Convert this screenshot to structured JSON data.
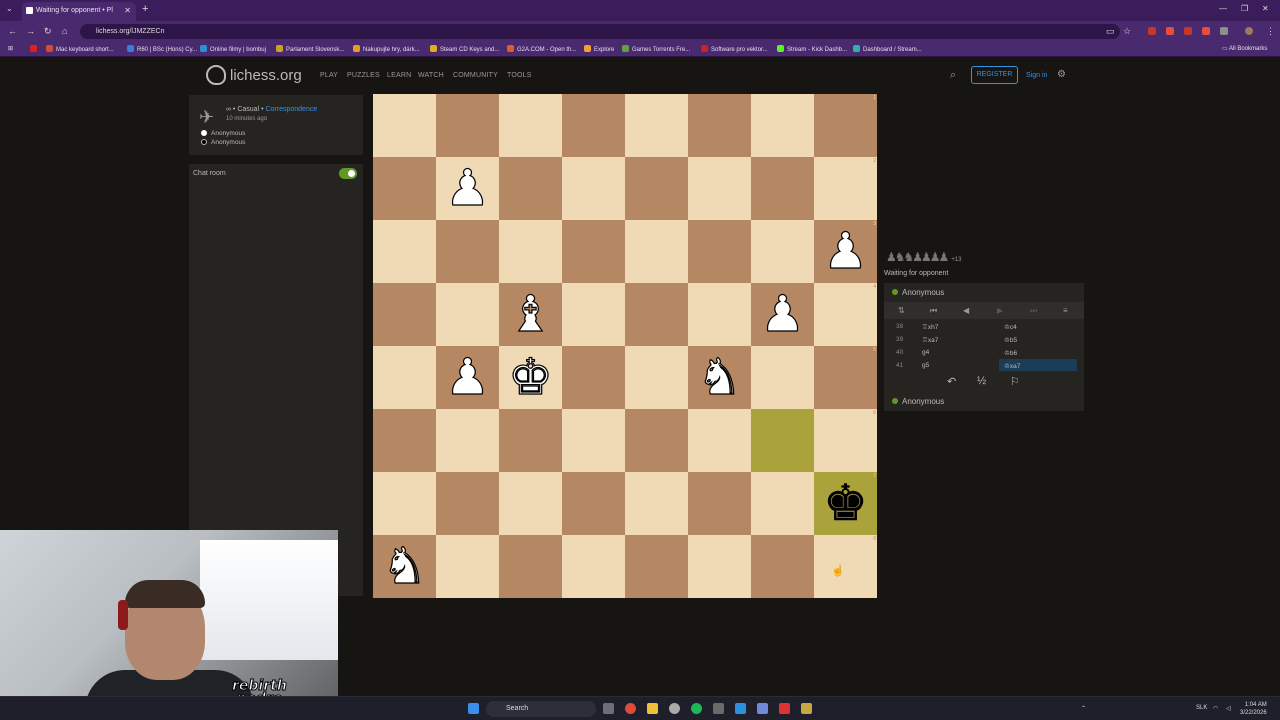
{
  "browser": {
    "tab_title": "Waiting for opponent • Pl",
    "url": "lichess.org/lJMZZECn",
    "bookmarks": [
      {
        "label": "Mac keyboard short...",
        "color": "#d14b3a"
      },
      {
        "label": "R60 | BSc (Hons) Cy...",
        "color": "#3b7dd8"
      },
      {
        "label": "Online filmy | bombuj",
        "color": "#2f8fd0"
      },
      {
        "label": "Parlament Slovensk...",
        "color": "#c9a227"
      },
      {
        "label": "Nakupujte hry, dárk...",
        "color": "#e0a020"
      },
      {
        "label": "Steam CD Keys and...",
        "color": "#e0b020"
      },
      {
        "label": "G2A.COM - Open th...",
        "color": "#e05a2a"
      },
      {
        "label": "Explore",
        "color": "#f0a030"
      },
      {
        "label": "Games Torrents Fre...",
        "color": "#62a043"
      },
      {
        "label": "Software pro vektor...",
        "color": "#d02020"
      },
      {
        "label": "Stream - Kick Dashb...",
        "color": "#53fc18"
      },
      {
        "label": "Dashboard / Stream...",
        "color": "#2ab3a6"
      }
    ],
    "all_bookmarks": "All Bookmarks"
  },
  "header": {
    "logo": "lichess.org",
    "nav": [
      "PLAY",
      "PUZZLES",
      "LEARN",
      "WATCH",
      "COMMUNITY",
      "TOOLS"
    ],
    "register": "REGISTER",
    "signin": "Sign in"
  },
  "game_meta": {
    "type_prefix": "∞ • Casual • ",
    "type_link": "Correspondence",
    "time_ago": "10 minutes ago",
    "players": [
      "Anonymous",
      "Anonymous"
    ]
  },
  "chat": {
    "label": "Chat room",
    "enabled": true
  },
  "board": {
    "light": "#f0d9b5",
    "dark": "#b58863",
    "highlight": "#aaa23a",
    "orientation": "black",
    "pieces": [
      {
        "glyph": "♟",
        "color": "w",
        "file": 1,
        "rank": 1,
        "name": "white-pawn"
      },
      {
        "glyph": "♟",
        "color": "w",
        "file": 7,
        "rank": 2,
        "name": "white-pawn"
      },
      {
        "glyph": "♝",
        "color": "w",
        "file": 2,
        "rank": 3,
        "name": "white-bishop"
      },
      {
        "glyph": "♟",
        "color": "w",
        "file": 6,
        "rank": 3,
        "name": "white-pawn"
      },
      {
        "glyph": "♟",
        "color": "w",
        "file": 1,
        "rank": 4,
        "name": "white-pawn"
      },
      {
        "glyph": "♚",
        "color": "w",
        "file": 2,
        "rank": 4,
        "name": "white-king"
      },
      {
        "glyph": "♞",
        "color": "w",
        "file": 5,
        "rank": 4,
        "name": "white-knight"
      },
      {
        "glyph": "♚",
        "color": "b",
        "file": 7,
        "rank": 6,
        "name": "black-king"
      },
      {
        "glyph": "♞",
        "color": "w",
        "file": 0,
        "rank": 7,
        "name": "white-knight"
      }
    ],
    "highlights": [
      {
        "file": 6,
        "rank": 5
      },
      {
        "file": 7,
        "rank": 6
      }
    ],
    "rank_labels": [
      "1",
      "2",
      "3",
      "4",
      "5",
      "6",
      "7",
      "8"
    ],
    "file_labels": [
      "h",
      "g",
      "f",
      "e",
      "d",
      "c",
      "b",
      "a"
    ]
  },
  "right_panel": {
    "material": "♟♞♞♟♟♟♟",
    "material_diff": "+13",
    "status": "Waiting for opponent",
    "top_player": "Anonymous",
    "bottom_player": "Anonymous",
    "moves": [
      {
        "no": "38",
        "white": "♖xh7",
        "black": "♔c4"
      },
      {
        "no": "39",
        "white": "♖xa7",
        "black": "♔b5"
      },
      {
        "no": "40",
        "white": "g4",
        "black": "♔b6"
      },
      {
        "no": "41",
        "white": "g5",
        "black": "♔xa7"
      }
    ],
    "draw_symbol": "½"
  },
  "taskbar": {
    "search": "Search",
    "lang": "SLK",
    "time": "1:04 AM",
    "date": "3/22/2026"
  },
  "webcam": {
    "overlay_text": [
      "rebirth",
      "pedro"
    ]
  }
}
